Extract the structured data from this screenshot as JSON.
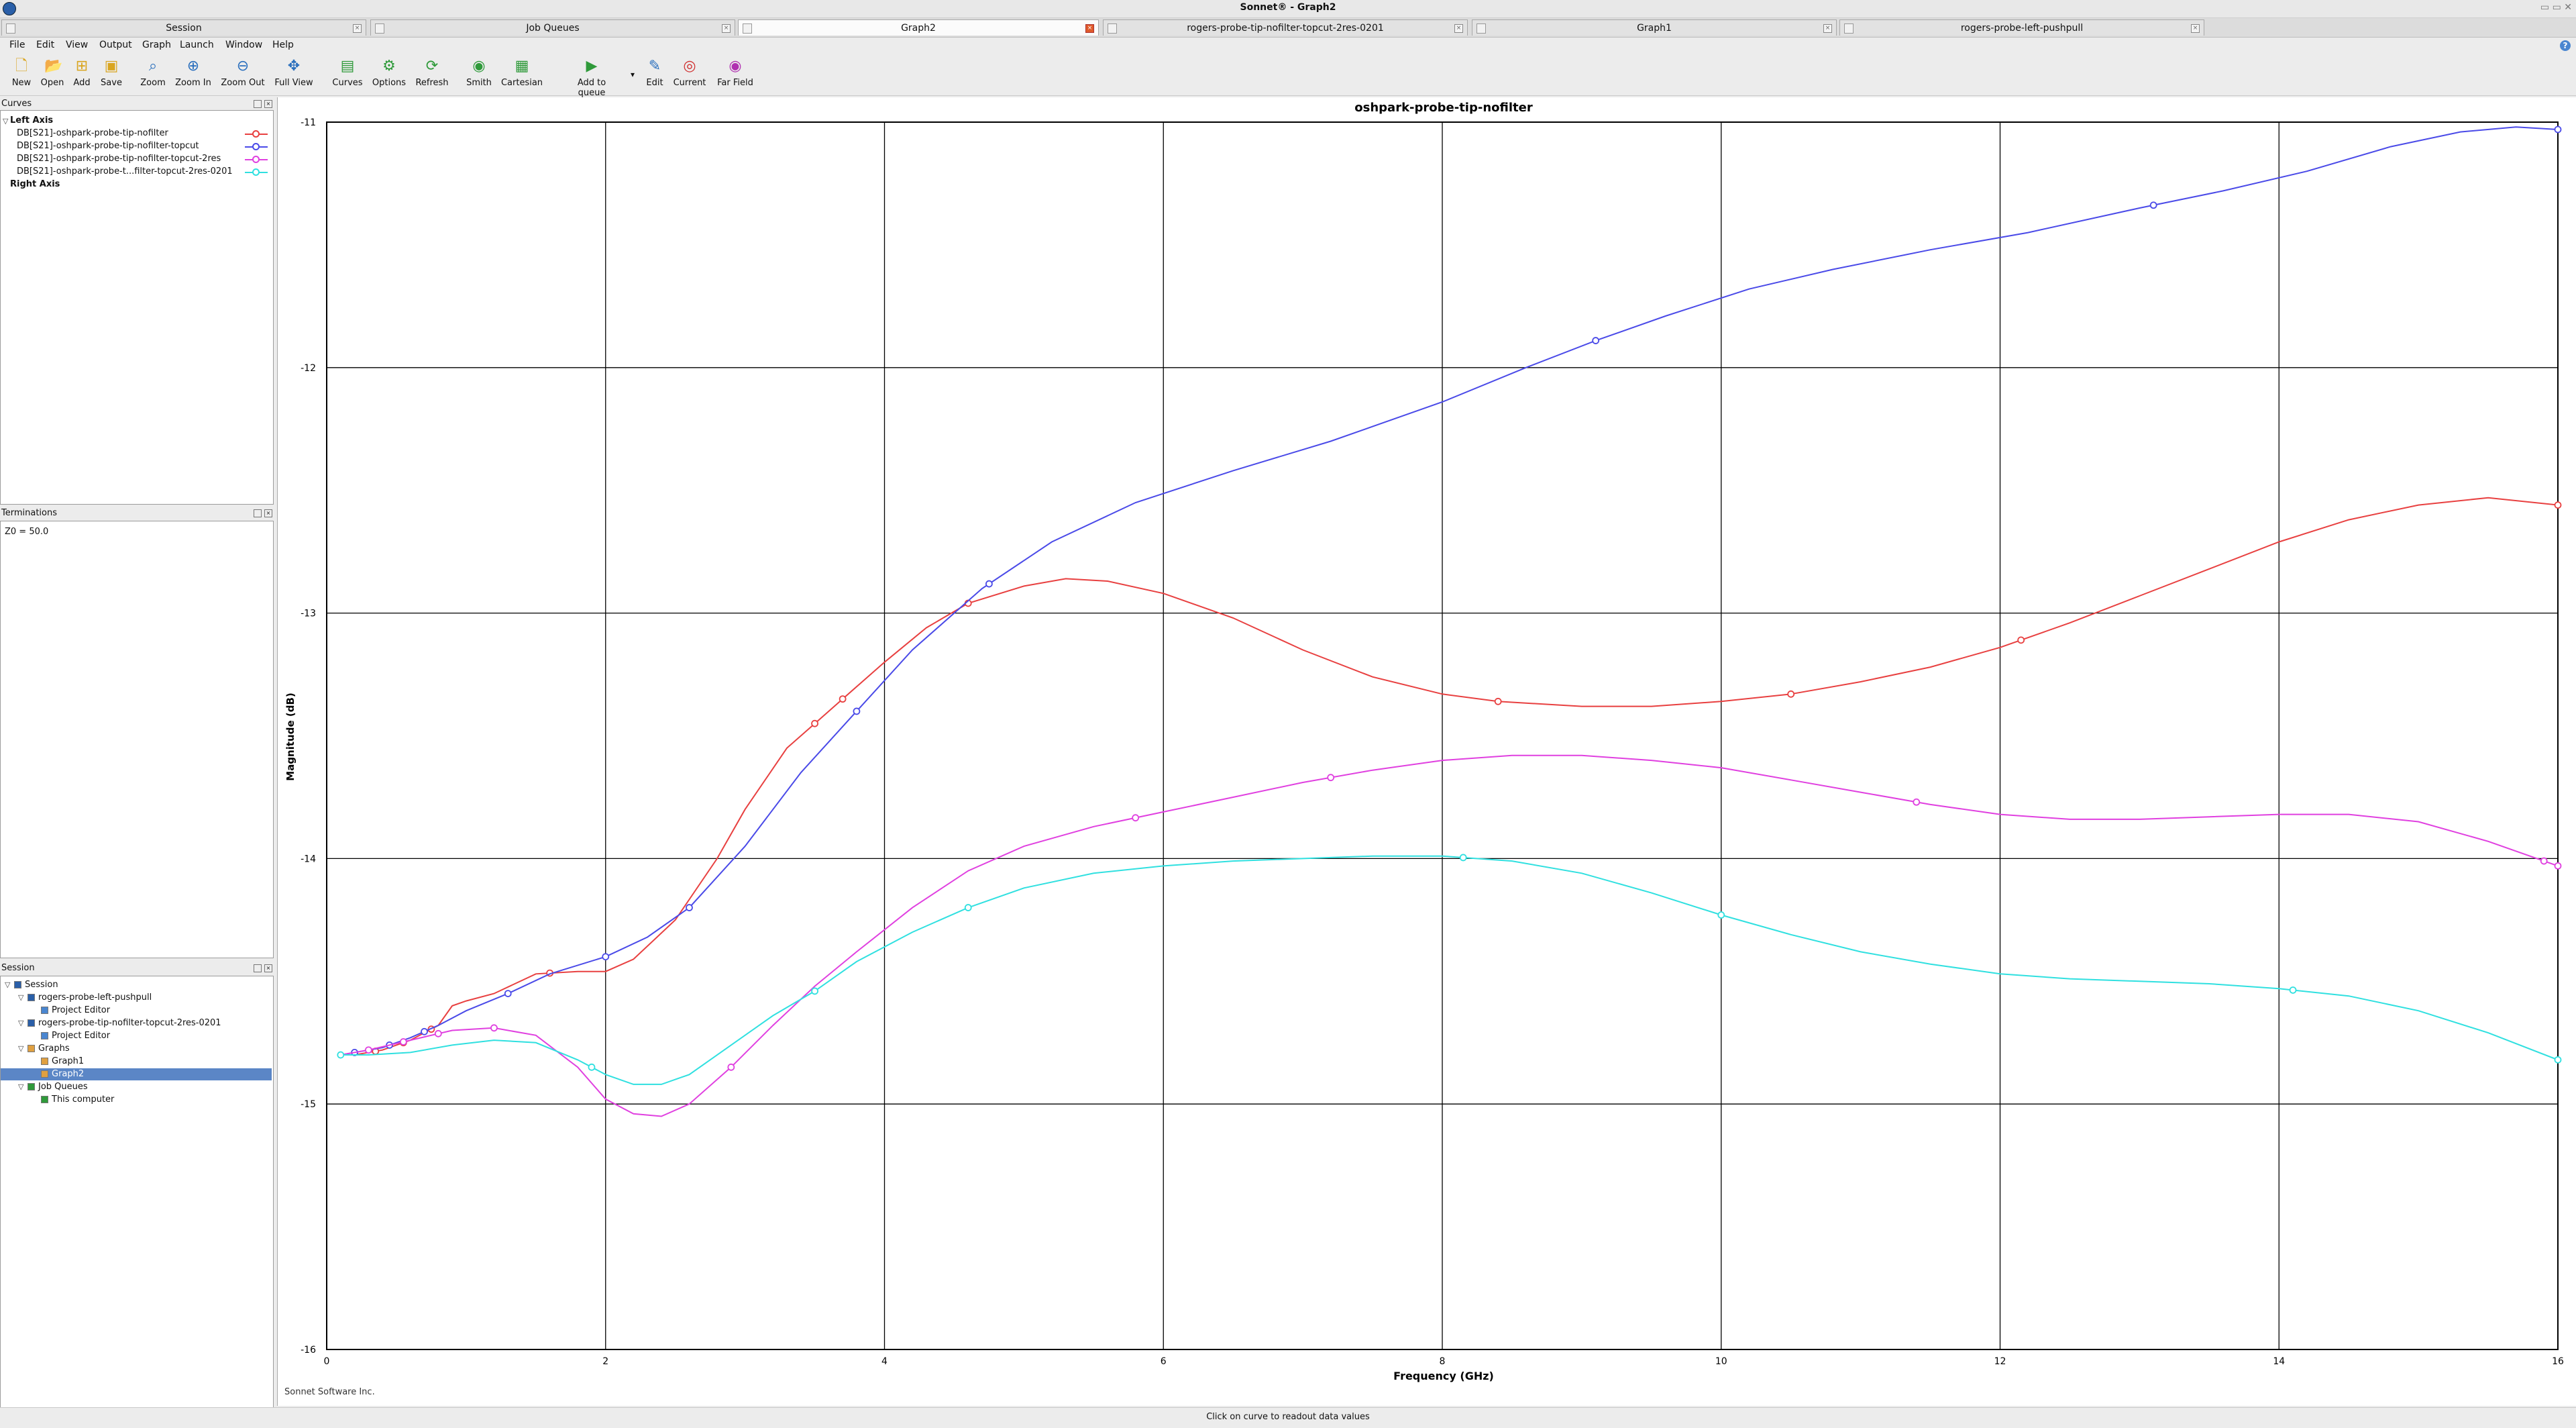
{
  "window": {
    "title": "Sonnet® - Graph2"
  },
  "tabs": [
    {
      "label": "Session",
      "active": false
    },
    {
      "label": "Job Queues",
      "active": false
    },
    {
      "label": "Graph2",
      "active": true
    },
    {
      "label": "rogers-probe-tip-nofilter-topcut-2res-0201",
      "active": false
    },
    {
      "label": "Graph1",
      "active": false
    },
    {
      "label": "rogers-probe-left-pushpull",
      "active": false
    }
  ],
  "menu": [
    "File",
    "Edit",
    "View",
    "Output",
    "Graph",
    "Launch",
    "Window",
    "Help"
  ],
  "toolbar": [
    {
      "label": "New",
      "icon": "new-file-icon",
      "glyph": "🗋",
      "color": "#d9a520"
    },
    {
      "label": "Open",
      "icon": "open-folder-icon",
      "glyph": "📂",
      "color": "#d9a520"
    },
    {
      "label": "Add",
      "icon": "add-icon",
      "glyph": "⊞",
      "color": "#d9a520"
    },
    {
      "label": "Save",
      "icon": "save-icon",
      "glyph": "▣",
      "color": "#d9a520"
    },
    {
      "label": "Zoom",
      "icon": "zoom-icon",
      "glyph": "⌕",
      "color": "#2a6fbd"
    },
    {
      "label": "Zoom In",
      "icon": "zoom-in-icon",
      "glyph": "⊕",
      "color": "#2a6fbd"
    },
    {
      "label": "Zoom Out",
      "icon": "zoom-out-icon",
      "glyph": "⊖",
      "color": "#2a6fbd"
    },
    {
      "label": "Full View",
      "icon": "full-view-icon",
      "glyph": "✥",
      "color": "#2a6fbd"
    },
    {
      "label": "Curves",
      "icon": "curves-icon",
      "glyph": "▤",
      "color": "#2f9a3a"
    },
    {
      "label": "Options",
      "icon": "options-icon",
      "glyph": "⚙",
      "color": "#2f9a3a"
    },
    {
      "label": "Refresh",
      "icon": "refresh-icon",
      "glyph": "⟳",
      "color": "#2f9a3a"
    },
    {
      "label": "Smith",
      "icon": "smith-chart-icon",
      "glyph": "◉",
      "color": "#2f9a3a"
    },
    {
      "label": "Cartesian",
      "icon": "cartesian-icon",
      "glyph": "▦",
      "color": "#2f9a3a"
    },
    {
      "label": "Add to queue",
      "icon": "add-to-queue-icon",
      "glyph": "▶",
      "color": "#2f9a3a"
    },
    {
      "label": "Edit",
      "icon": "edit-icon",
      "glyph": "✎",
      "color": "#2a6fbd"
    },
    {
      "label": "Current",
      "icon": "current-icon",
      "glyph": "◎",
      "color": "#d03030"
    },
    {
      "label": "Far Field",
      "icon": "far-field-icon",
      "glyph": "◉",
      "color": "#b030b0"
    }
  ],
  "curves_panel": {
    "title": "Curves",
    "left_axis_label": "Left Axis",
    "right_axis_label": "Right Axis",
    "items": [
      {
        "label": "DB[S21]-oshpark-probe-tip-nofilter",
        "color": "#e84040"
      },
      {
        "label": "DB[S21]-oshpark-probe-tip-nofilter-topcut",
        "color": "#4a4ae8"
      },
      {
        "label": "DB[S21]-oshpark-probe-tip-nofilter-topcut-2res",
        "color": "#e040e0"
      },
      {
        "label": "DB[S21]-oshpark-probe-t...filter-topcut-2res-0201",
        "color": "#30e0e0"
      }
    ]
  },
  "terminations_panel": {
    "title": "Terminations",
    "text": "Z0 = 50.0"
  },
  "session_panel": {
    "title": "Session",
    "tree": [
      {
        "label": "Session",
        "level": 0
      },
      {
        "label": "rogers-probe-left-pushpull",
        "level": 1
      },
      {
        "label": "Project Editor",
        "level": 2
      },
      {
        "label": "rogers-probe-tip-nofilter-topcut-2res-0201",
        "level": 1
      },
      {
        "label": "Project Editor",
        "level": 2
      },
      {
        "label": "Graphs",
        "level": 1
      },
      {
        "label": "Graph1",
        "level": 2
      },
      {
        "label": "Graph2",
        "level": 2,
        "selected": true
      },
      {
        "label": "Job Queues",
        "level": 1
      },
      {
        "label": "This computer",
        "level": 2
      }
    ]
  },
  "footer_text": "Sonnet Software Inc.",
  "status_text": "Click on curve to readout data values",
  "chart_data": {
    "type": "line",
    "title": "oshpark-probe-tip-nofilter",
    "xlabel": "Frequency (GHz)",
    "ylabel": "Magnitude (dB)",
    "xlim": [
      0,
      16
    ],
    "ylim": [
      -16,
      -11
    ],
    "xticks": [
      "0",
      "2",
      "4",
      "6",
      "8",
      "10",
      "12",
      "14",
      "16"
    ],
    "yticks": [
      "-11",
      "-12",
      "-13",
      "-14",
      "-15",
      "-16"
    ],
    "grid": true,
    "series": [
      {
        "name": "DB[S21]-oshpark-probe-tip-nofilter",
        "color": "#e84040",
        "x": [
          0.1,
          0.2,
          0.4,
          0.6,
          0.8,
          0.9,
          1.0,
          1.2,
          1.5,
          1.8,
          2.0,
          2.2,
          2.5,
          2.8,
          3.0,
          3.3,
          3.5,
          3.7,
          4.0,
          4.3,
          4.6,
          5.0,
          5.3,
          5.6,
          6.0,
          6.5,
          7.0,
          7.5,
          8.0,
          8.4,
          9.0,
          9.5,
          10.0,
          10.5,
          11.0,
          11.5,
          12.0,
          12.5,
          13.0,
          13.5,
          14.0,
          14.5,
          15.0,
          15.5,
          16.0
        ],
        "y": [
          -14.8,
          -14.8,
          -14.78,
          -14.74,
          -14.68,
          -14.6,
          -14.58,
          -14.55,
          -14.47,
          -14.46,
          -14.46,
          -14.41,
          -14.25,
          -14.0,
          -13.8,
          -13.55,
          -13.45,
          -13.35,
          -13.2,
          -13.06,
          -12.96,
          -12.89,
          -12.86,
          -12.87,
          -12.92,
          -13.02,
          -13.15,
          -13.26,
          -13.33,
          -13.36,
          -13.38,
          -13.38,
          -13.36,
          -13.33,
          -13.28,
          -13.22,
          -13.14,
          -13.04,
          -12.93,
          -12.82,
          -12.71,
          -12.62,
          -12.56,
          -12.53,
          -12.56
        ],
        "markers_x": [
          0.35,
          0.55,
          0.75,
          1.6,
          3.5,
          3.7,
          4.6,
          8.4,
          10.5,
          12.15,
          16.0
        ]
      },
      {
        "name": "DB[S21]-oshpark-probe-tip-nofilter-topcut",
        "color": "#4a4ae8",
        "x": [
          0.1,
          0.2,
          0.4,
          0.6,
          0.8,
          1.0,
          1.3,
          1.6,
          2.0,
          2.3,
          2.6,
          3.0,
          3.4,
          3.8,
          4.2,
          4.7,
          5.2,
          5.8,
          6.5,
          7.2,
          8.0,
          8.6,
          9.1,
          9.6,
          10.2,
          10.8,
          11.5,
          12.2,
          13.0,
          13.6,
          14.2,
          14.8,
          15.3,
          15.7,
          16.0
        ],
        "y": [
          -14.8,
          -14.79,
          -14.77,
          -14.73,
          -14.68,
          -14.62,
          -14.55,
          -14.47,
          -14.4,
          -14.32,
          -14.2,
          -13.95,
          -13.65,
          -13.4,
          -13.15,
          -12.9,
          -12.71,
          -12.55,
          -12.42,
          -12.3,
          -12.14,
          -12.0,
          -11.89,
          -11.79,
          -11.68,
          -11.6,
          -11.52,
          -11.45,
          -11.35,
          -11.28,
          -11.2,
          -11.1,
          -11.04,
          -11.02,
          -11.03
        ],
        "markers_x": [
          0.2,
          0.45,
          0.7,
          1.3,
          2.0,
          2.6,
          3.8,
          4.75,
          9.1,
          13.1,
          16.0
        ]
      },
      {
        "name": "DB[S21]-oshpark-probe-tip-nofilter-topcut-2res",
        "color": "#e040e0",
        "x": [
          0.1,
          0.3,
          0.6,
          0.9,
          1.2,
          1.5,
          1.8,
          2.0,
          2.2,
          2.4,
          2.6,
          2.9,
          3.2,
          3.5,
          3.8,
          4.2,
          4.6,
          5.0,
          5.5,
          6.0,
          6.5,
          7.0,
          7.5,
          8.0,
          8.5,
          9.0,
          9.5,
          10.0,
          10.5,
          11.0,
          11.5,
          12.0,
          12.5,
          13.0,
          13.5,
          14.0,
          14.5,
          15.0,
          15.5,
          16.0
        ],
        "y": [
          -14.8,
          -14.78,
          -14.74,
          -14.7,
          -14.69,
          -14.72,
          -14.85,
          -14.98,
          -15.04,
          -15.05,
          -15.0,
          -14.85,
          -14.68,
          -14.52,
          -14.38,
          -14.2,
          -14.05,
          -13.95,
          -13.87,
          -13.81,
          -13.75,
          -13.69,
          -13.64,
          -13.6,
          -13.58,
          -13.58,
          -13.6,
          -13.63,
          -13.68,
          -13.73,
          -13.78,
          -13.82,
          -13.84,
          -13.84,
          -13.83,
          -13.82,
          -13.82,
          -13.85,
          -13.93,
          -14.03
        ],
        "markers_x": [
          0.3,
          0.55,
          0.8,
          1.2,
          2.9,
          5.8,
          7.2,
          11.4,
          15.9,
          16.0
        ]
      },
      {
        "name": "DB[S21]-oshpark-probe-t...filter-topcut-2res-0201",
        "color": "#30e0e0",
        "x": [
          0.1,
          0.3,
          0.6,
          0.9,
          1.2,
          1.5,
          1.8,
          2.0,
          2.2,
          2.4,
          2.6,
          2.9,
          3.2,
          3.5,
          3.8,
          4.2,
          4.6,
          5.0,
          5.5,
          6.0,
          6.5,
          7.0,
          7.5,
          8.0,
          8.5,
          9.0,
          9.5,
          10.0,
          10.5,
          11.0,
          11.5,
          12.0,
          12.5,
          13.0,
          13.5,
          14.0,
          14.5,
          15.0,
          15.5,
          16.0
        ],
        "y": [
          -14.8,
          -14.8,
          -14.79,
          -14.76,
          -14.74,
          -14.75,
          -14.82,
          -14.88,
          -14.92,
          -14.92,
          -14.88,
          -14.76,
          -14.64,
          -14.54,
          -14.42,
          -14.3,
          -14.2,
          -14.12,
          -14.06,
          -14.03,
          -14.01,
          -14.0,
          -13.99,
          -13.99,
          -14.01,
          -14.06,
          -14.14,
          -14.23,
          -14.31,
          -14.38,
          -14.43,
          -14.47,
          -14.49,
          -14.5,
          -14.51,
          -14.53,
          -14.56,
          -14.62,
          -14.71,
          -14.82
        ],
        "markers_x": [
          0.1,
          1.9,
          3.5,
          4.6,
          8.15,
          10.0,
          14.1,
          16.0
        ]
      }
    ]
  }
}
